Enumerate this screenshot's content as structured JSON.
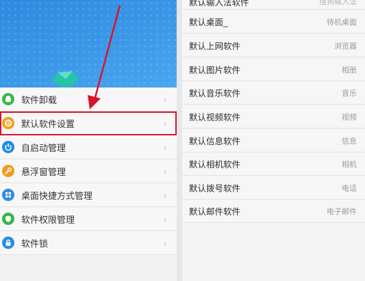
{
  "left_panel": {
    "menu": [
      {
        "label": "软件卸载",
        "icon": "android-icon",
        "color": "#3db94a"
      },
      {
        "label": "默认软件设置",
        "icon": "gear-icon",
        "color": "#f2a31b"
      },
      {
        "label": "自启动管理",
        "icon": "power-icon",
        "color": "#1e8ee0"
      },
      {
        "label": "悬浮窗管理",
        "icon": "wrench-icon",
        "color": "#f29b1a"
      },
      {
        "label": "桌面快捷方式管理",
        "icon": "grid-icon",
        "color": "#2f8de4"
      },
      {
        "label": "软件权限管理",
        "icon": "shield-icon",
        "color": "#3ab44a"
      },
      {
        "label": "软件锁",
        "icon": "lock-icon",
        "color": "#2b8be2"
      }
    ],
    "highlight_color": "#d9122a"
  },
  "right_panel": {
    "top_row": {
      "label": "默认输入法软件",
      "value": "搜狗输入法"
    },
    "rows": [
      {
        "label": "默认桌面_",
        "value": "待机桌面"
      },
      {
        "label": "默认上网软件",
        "value": "浏览器"
      },
      {
        "label": "默认图片软件",
        "value": "相册"
      },
      {
        "label": "默认音乐软件",
        "value": "音乐"
      },
      {
        "label": "默认视频软件",
        "value": "视频"
      },
      {
        "label": "默认信息软件",
        "value": "信息"
      },
      {
        "label": "默认相机软件",
        "value": "相机"
      },
      {
        "label": "默认拨号软件",
        "value": "电话"
      },
      {
        "label": "默认邮件软件",
        "value": "电子邮件"
      }
    ]
  }
}
